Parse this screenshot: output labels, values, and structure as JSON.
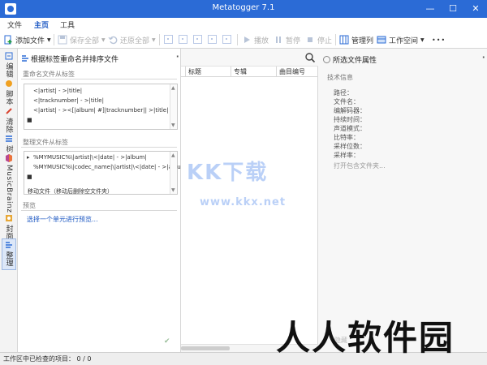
{
  "window": {
    "title": "Metatogger 7.1",
    "minimize": "—",
    "maximize": "☐",
    "close": "✕"
  },
  "menu": {
    "file": "文件",
    "home": "主页",
    "tools": "工具"
  },
  "toolbar": {
    "add_files": "添加文件",
    "save_all": "保存全部",
    "restore_all": "还原全部",
    "play": "播放",
    "pause": "暂停",
    "stop": "停止",
    "manage_columns": "管理列",
    "workspace": "工作空间",
    "more": "•••"
  },
  "sidetabs": [
    {
      "label": "编辑",
      "icon": "edit-icon"
    },
    {
      "label": "脚本",
      "icon": "script-icon"
    },
    {
      "label": "清除",
      "icon": "clean-icon"
    },
    {
      "label": "树",
      "icon": "tree-icon"
    },
    {
      "label": "MusicBrainz",
      "icon": "musicbrainz-icon"
    },
    {
      "label": "封面",
      "icon": "cover-icon"
    },
    {
      "label": "整理",
      "icon": "organize-icon"
    }
  ],
  "actions": {
    "title": "根据标签重命名并排序文件",
    "pin": "⬝",
    "rename_label": "重命名文件从标签",
    "rename_formats": [
      "<|artist| - >|title|",
      "<|tracknumber| - >|title|",
      "<|artist| - ><[|album| #]|tracknumber|| >|title|"
    ],
    "organize_label": "整理文件从标签",
    "organize_formats": [
      "%MYMUSIC%\\|artist|\\<|date| - >|album|",
      "%MYMUSIC%\\|codec_name|\\|artist|\\<|date| - >|album|"
    ],
    "move_files": "移动文件（移动后删除空文件夹）",
    "preview_label": "预览",
    "preview_link": "选择一个单元进行预览...",
    "apply": "✔",
    "bullet": "■",
    "row_marker": "▸"
  },
  "filelist": {
    "columns": [
      "",
      "标题",
      "专辑",
      "曲目编号"
    ],
    "hidden_hint": "隐藏"
  },
  "properties": {
    "title": "所选文件属性",
    "section": "技术信息",
    "fields": [
      "路径：",
      "文件名：",
      "编解码器：",
      "持续时间：",
      "声道模式：",
      "比特率：",
      "采样位数：",
      "采样率："
    ],
    "open_folder": "打开包含文件夹..."
  },
  "status": {
    "text": "工作区中已检查的项目： 0 / 0"
  },
  "watermarks": {
    "main": "KK下载",
    "url": "www.kkx.net",
    "brand": "人人软件园"
  },
  "colors": {
    "accent": "#2b6bd6",
    "link": "#1a56c2",
    "tab_active": "#dce7f8"
  }
}
